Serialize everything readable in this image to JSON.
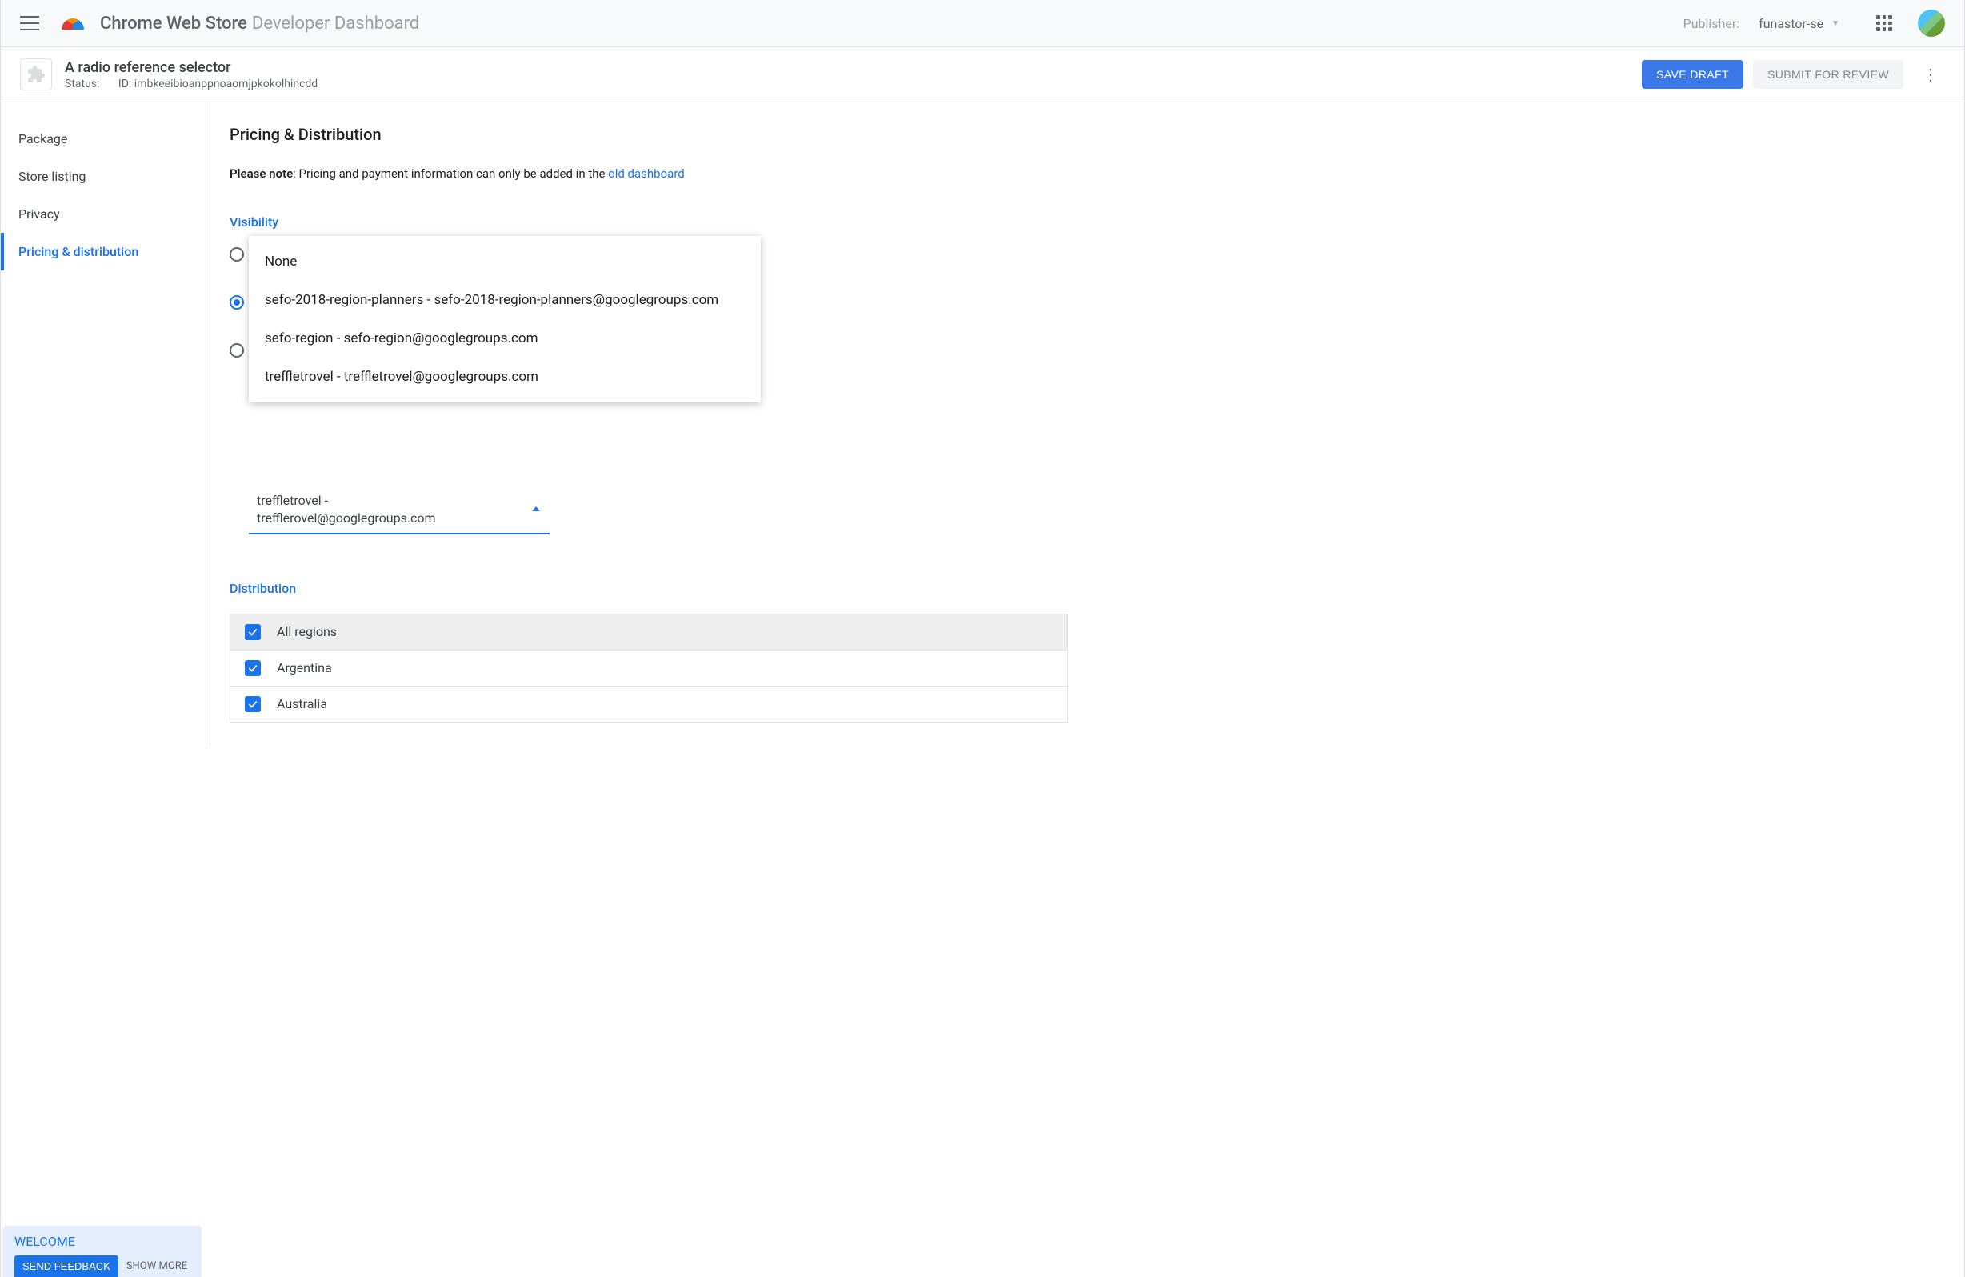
{
  "header": {
    "title_strong": "Chrome Web Store",
    "title_light": "Developer Dashboard",
    "publisher_label": "Publisher:",
    "publisher_value": "funastor-se"
  },
  "item": {
    "name": "A radio reference selector",
    "status_label": "Status:",
    "id_label": "ID:",
    "id_value": "imbkeeibioanppnoaomjpkokolhincdd",
    "save_draft": "SAVE DRAFT",
    "submit_review": "SUBMIT FOR REVIEW"
  },
  "sidebar": {
    "items": [
      {
        "label": "Package"
      },
      {
        "label": "Store listing"
      },
      {
        "label": "Privacy"
      },
      {
        "label": "Pricing & distribution"
      }
    ]
  },
  "page": {
    "title": "Pricing & Distribution",
    "note_strong": "Please note",
    "note_text": ": Pricing and payment information can only be added in the ",
    "note_link": "old dashboard",
    "visibility_label": "Visibility",
    "distribution_label": "Distribution"
  },
  "group_select": {
    "current_line1": "treffletrovel -",
    "current_line2": "trefflerovel@googlegroups.com",
    "options": [
      "None",
      "sefo-2018-region-planners - sefo-2018-region-planners@googlegroups.com",
      "sefo-region - sefo-region@googlegroups.com",
      "treffletrovel - treffletrovel@googlegroups.com"
    ]
  },
  "distribution": {
    "rows": [
      {
        "label": "All regions"
      },
      {
        "label": "Argentina"
      },
      {
        "label": "Australia"
      }
    ]
  },
  "welcome": {
    "title": "WELCOME",
    "send_feedback": "SEND FEEDBACK",
    "show_more": "SHOW MORE"
  }
}
